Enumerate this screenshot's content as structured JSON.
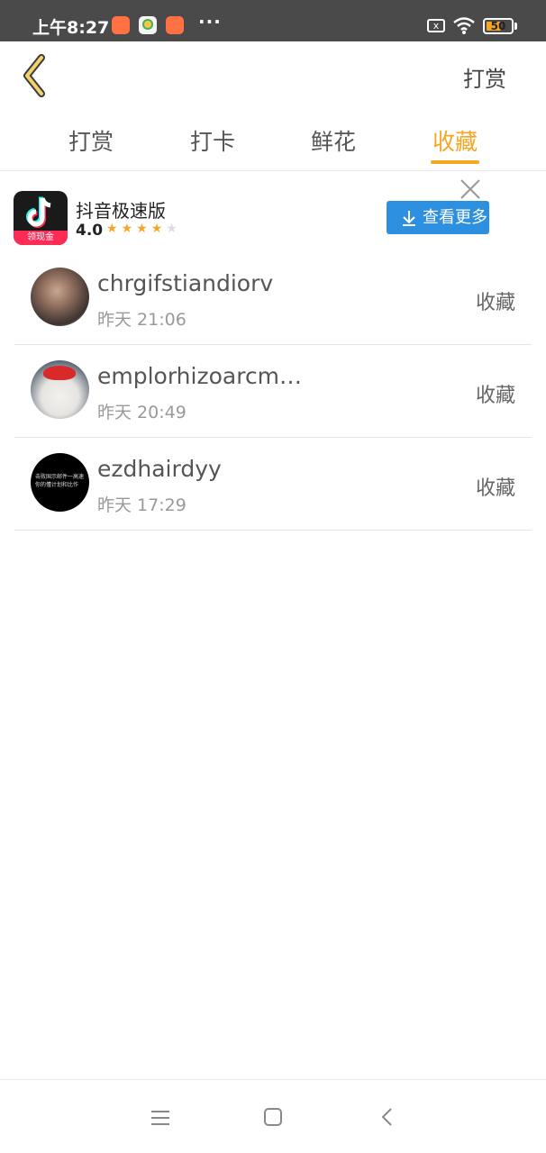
{
  "status_bar": {
    "time": "上午8:27",
    "dots": "···",
    "sim_icon": "x",
    "battery": "50",
    "notification_icons": [
      "shopping-app-icon",
      "chat-app-icon",
      "shopping-app-icon"
    ]
  },
  "header": {
    "back_icon": "chevron-left-icon",
    "action_label": "打赏"
  },
  "tabs": [
    {
      "label": "打赏",
      "active": false
    },
    {
      "label": "打卡",
      "active": false
    },
    {
      "label": "鲜花",
      "active": false
    },
    {
      "label": "收藏",
      "active": true
    }
  ],
  "ad": {
    "app_name": "抖音极速版",
    "badge": "领现金",
    "rating": "4.0",
    "stars_filled": 4,
    "stars_total": 5,
    "button_label": "查看更多"
  },
  "list": [
    {
      "name": "chrgifstiandiorv",
      "time": "昨天 21:06",
      "action": "收藏"
    },
    {
      "name": "emplorhizoarcm…",
      "time": "昨天 20:49",
      "action": "收藏"
    },
    {
      "name": "ezdhairdyy",
      "time": "昨天 17:29",
      "action": "收藏",
      "avatar_text": "击败国示邮件一高速 你的懂计划和比作"
    }
  ],
  "colors": {
    "accent": "#f5a623",
    "ad_button": "#2d8fe0",
    "status_bar": "#4a4a4a"
  }
}
